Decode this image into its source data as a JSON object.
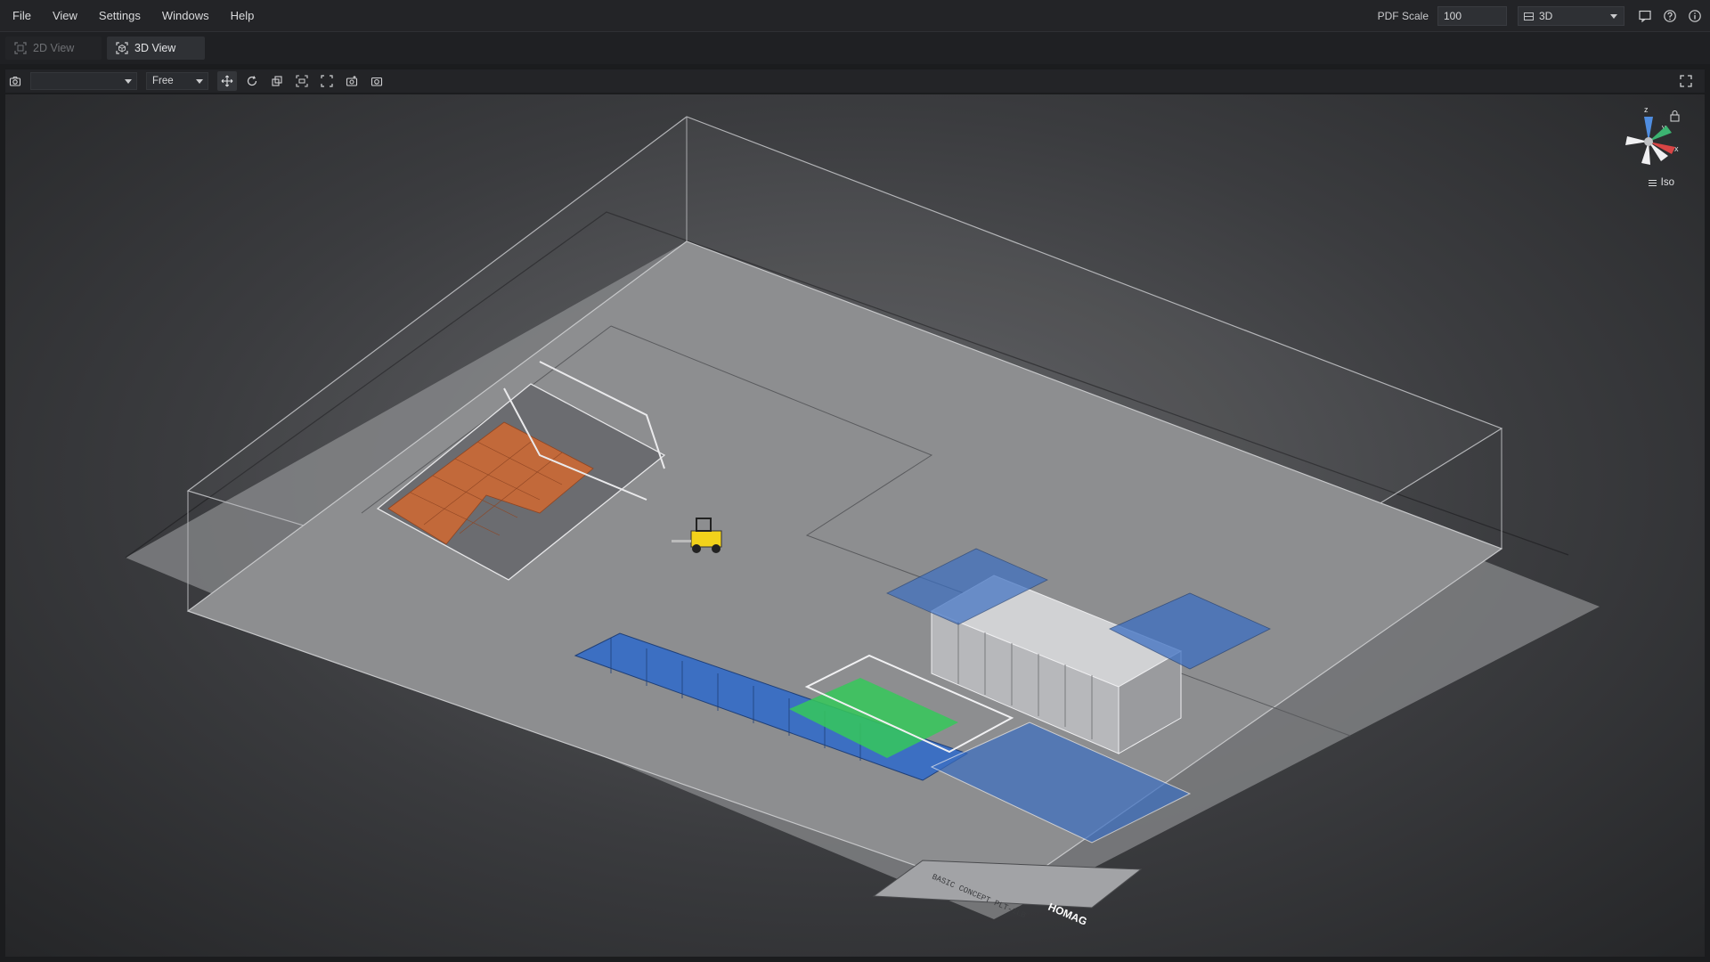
{
  "menu": {
    "items": [
      {
        "label": "File"
      },
      {
        "label": "View"
      },
      {
        "label": "Settings"
      },
      {
        "label": "Windows"
      },
      {
        "label": "Help"
      }
    ]
  },
  "topbar": {
    "pdf_scale_label": "PDF Scale",
    "pdf_scale_value": "100",
    "view_mode_value": "3D",
    "icons": [
      "comment-icon",
      "help-icon",
      "info-icon"
    ]
  },
  "tabs": [
    {
      "label": "2D View",
      "active": false
    },
    {
      "label": "3D View",
      "active": true
    }
  ],
  "toolbar": {
    "camera_select_value": "",
    "projection_select_value": "Free",
    "tools": [
      "move-icon",
      "rotate-icon",
      "layers-icon",
      "fit-icon",
      "frame-icon",
      "snapshot-icon",
      "camera-icon"
    ]
  },
  "viewport": {
    "navigation_label": "Iso",
    "axes": {
      "x": "x",
      "y": "y",
      "z": "z"
    },
    "title_block_text": "BASIC CONCEPT PLT-1LB",
    "logo_text": "HOMAG",
    "colors": {
      "floor": "#8b8c8e",
      "conveyor_blue": "#2f6fd6",
      "pallet_orange": "#c2693a",
      "forklift_yellow": "#f2d21b",
      "green_zone": "#35c95a"
    }
  }
}
